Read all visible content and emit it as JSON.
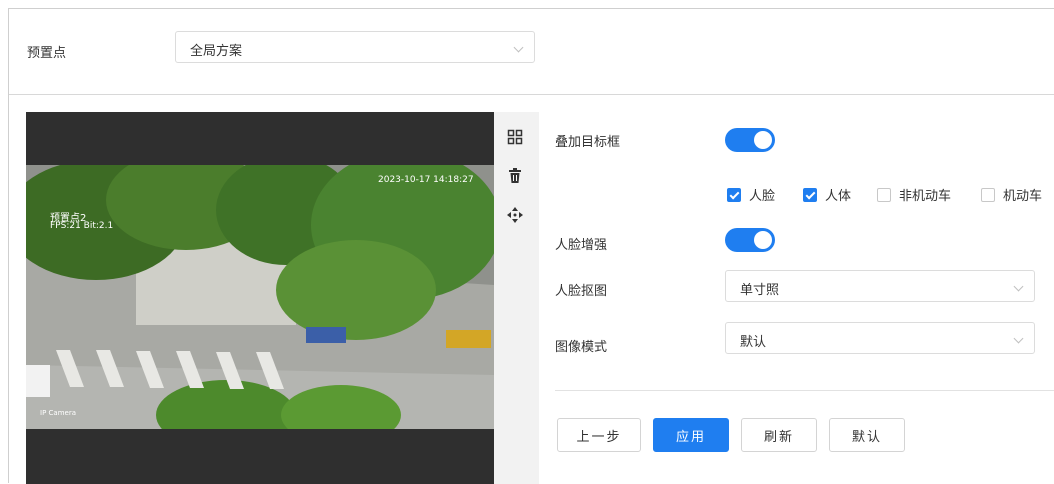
{
  "preset": {
    "label": "预置点",
    "value": "全局方案"
  },
  "video": {
    "timestamp": "2023-10-17 14:18:27",
    "channel": "预置点2",
    "fps": "FPS:21 Bit:2.1",
    "corner": "IP Camera"
  },
  "toolbar": {
    "icons": [
      "grid-icon",
      "trash-icon",
      "move-icon"
    ]
  },
  "overlay": {
    "label": "叠加目标框",
    "enabled": true,
    "targets": [
      {
        "label": "人脸",
        "checked": true
      },
      {
        "label": "人体",
        "checked": true
      },
      {
        "label": "非机动车",
        "checked": false
      },
      {
        "label": "机动车",
        "checked": false
      }
    ]
  },
  "face_enhance": {
    "label": "人脸增强",
    "enabled": true
  },
  "face_crop": {
    "label": "人脸抠图",
    "value": "单寸照"
  },
  "image_mode": {
    "label": "图像模式",
    "value": "默认"
  },
  "buttons": {
    "prev": "上一步",
    "apply": "应用",
    "refresh": "刷新",
    "default": "默认"
  },
  "colors": {
    "accent": "#1f7ef0"
  }
}
